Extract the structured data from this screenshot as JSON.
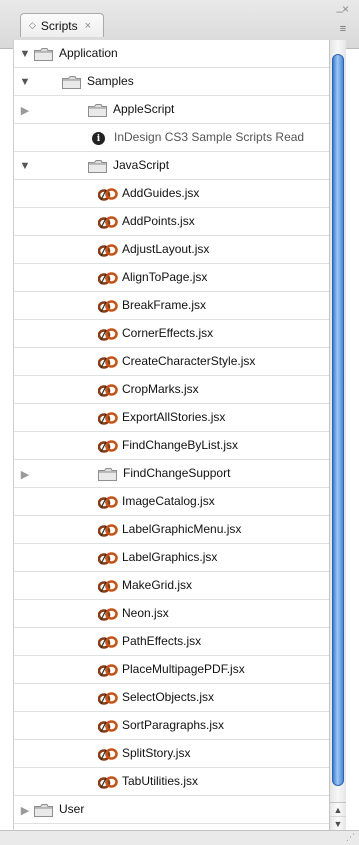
{
  "panel": {
    "tab_label": "Scripts",
    "tab_close": "×",
    "window_close": "×",
    "window_minimize": "–",
    "menu_icon": "≡"
  },
  "tree": [
    {
      "label": "Application",
      "kind": "folder",
      "expanded": true,
      "level": 0
    },
    {
      "label": "Samples",
      "kind": "folder",
      "expanded": true,
      "level": 1
    },
    {
      "label": "AppleScript",
      "kind": "folder",
      "expanded": false,
      "level": 2
    },
    {
      "label": "InDesign CS3 Sample Scripts Read",
      "kind": "info",
      "level": 2
    },
    {
      "label": "JavaScript",
      "kind": "folder",
      "expanded": true,
      "level": 2
    },
    {
      "label": "AddGuides.jsx",
      "kind": "script",
      "level": 3
    },
    {
      "label": "AddPoints.jsx",
      "kind": "script",
      "level": 3
    },
    {
      "label": "AdjustLayout.jsx",
      "kind": "script",
      "level": 3
    },
    {
      "label": "AlignToPage.jsx",
      "kind": "script",
      "level": 3
    },
    {
      "label": "BreakFrame.jsx",
      "kind": "script",
      "level": 3
    },
    {
      "label": "CornerEffects.jsx",
      "kind": "script",
      "level": 3
    },
    {
      "label": "CreateCharacterStyle.jsx",
      "kind": "script",
      "level": 3
    },
    {
      "label": "CropMarks.jsx",
      "kind": "script",
      "level": 3
    },
    {
      "label": "ExportAllStories.jsx",
      "kind": "script",
      "level": 3
    },
    {
      "label": "FindChangeByList.jsx",
      "kind": "script",
      "level": 3
    },
    {
      "label": "FindChangeSupport",
      "kind": "folder",
      "expanded": false,
      "level": 3
    },
    {
      "label": "ImageCatalog.jsx",
      "kind": "script",
      "level": 3
    },
    {
      "label": "LabelGraphicMenu.jsx",
      "kind": "script",
      "level": 3
    },
    {
      "label": "LabelGraphics.jsx",
      "kind": "script",
      "level": 3
    },
    {
      "label": "MakeGrid.jsx",
      "kind": "script",
      "level": 3
    },
    {
      "label": "Neon.jsx",
      "kind": "script",
      "level": 3
    },
    {
      "label": "PathEffects.jsx",
      "kind": "script",
      "level": 3
    },
    {
      "label": "PlaceMultipagePDF.jsx",
      "kind": "script",
      "level": 3
    },
    {
      "label": "SelectObjects.jsx",
      "kind": "script",
      "level": 3
    },
    {
      "label": "SortParagraphs.jsx",
      "kind": "script",
      "level": 3
    },
    {
      "label": "SplitStory.jsx",
      "kind": "script",
      "level": 3
    },
    {
      "label": "TabUtilities.jsx",
      "kind": "script",
      "level": 3
    },
    {
      "label": "User",
      "kind": "folder",
      "expanded": false,
      "level": 0
    }
  ],
  "scrollbar": {
    "up_arrow": "▲",
    "down_arrow": "▼"
  }
}
